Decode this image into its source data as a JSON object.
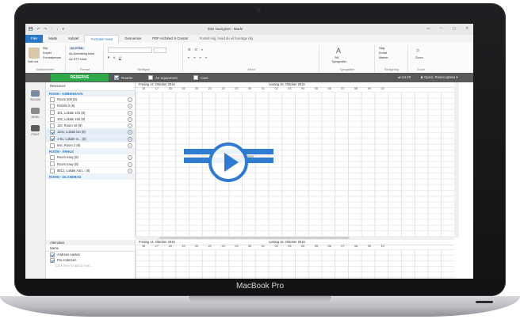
{
  "device": {
    "brand_label": "MacBook Pro"
  },
  "window": {
    "title": "Ikke navngivet - Møde",
    "quick_access": [
      "💾",
      "↶",
      "↷",
      "↑",
      "↓",
      "▾"
    ],
    "controls": [
      "▭",
      "—",
      "▢",
      "✕"
    ]
  },
  "ribbon_tabs": [
    {
      "label": "Filer",
      "style": "file"
    },
    {
      "label": "Møde",
      "style": ""
    },
    {
      "label": "Indsæt",
      "style": ""
    },
    {
      "label": "Formatér tekst",
      "style": "active"
    },
    {
      "label": "Gennemse",
      "style": ""
    },
    {
      "label": "PDF Architect 6 Creator",
      "style": ""
    },
    {
      "label": "Fortæl mig, hvad du vil foretage dig",
      "style": "tell"
    }
  ],
  "ribbon": {
    "clipboard": {
      "paste": "Sæt ind",
      "cut": "Klip",
      "copy": "Kopiér",
      "painter": "Formatpensel",
      "label": "Udklipsholder"
    },
    "format": {
      "html": "Aa HTML",
      "plain": "Aa Almindelig tekst",
      "rtf": "Aa RTF-tekst",
      "label": "Format"
    },
    "font": {
      "label": "Skrifttype"
    },
    "paragraph": {
      "label": "Afsnit"
    },
    "styles": {
      "label": "Typografier",
      "btn": "Stil",
      "btn2": "Typografier"
    },
    "editing": {
      "find": "Søg",
      "replace": "Erstat",
      "select": "Markér",
      "label": "Redigering"
    },
    "zoom": {
      "btn": "Zoom",
      "label": "Zoom"
    }
  },
  "toolbar": {
    "reserve": "RESERVE",
    "opt_rooms": "Rooms",
    "opt_equipment": "An equipment",
    "opt_cars": "Cars",
    "timezone": "⇄ 24.25",
    "user": "♟ Djord, Rivercoptera ▾"
  },
  "nav": [
    {
      "label": "ROOMS",
      "color": "#7a8aa0"
    },
    {
      "label": "MENU",
      "color": "#8a8a8a"
    },
    {
      "label": "PRINT",
      "color": "#5a5a5a"
    }
  ],
  "resources": {
    "header": "Resources",
    "section1": "ROOM - KØBENHAVN",
    "rows1": [
      {
        "label": "Room 200 (8)",
        "checked": false,
        "sel": false
      },
      {
        "label": "ROOM 2 (8)",
        "checked": false,
        "sel": false
      },
      {
        "label": "101, Lokale 101 (8)",
        "checked": false,
        "sel": false
      },
      {
        "label": "102, Lokale 102 (8)",
        "checked": false,
        "sel": false
      },
      {
        "label": "110, Room 10 (8)",
        "checked": false,
        "sel": false
      },
      {
        "label": "1104, Lokale lan (8)",
        "checked": true,
        "sel": true
      },
      {
        "label": "1-01, Lokale m... (8)",
        "checked": true,
        "sel": true
      },
      {
        "label": "test, Room 2 (8)",
        "checked": false,
        "sel": false
      }
    ],
    "section2": "ROOM - ÅRHUS",
    "rows2": [
      {
        "label": "Room easy (8)",
        "checked": false,
        "sel": false
      },
      {
        "label": "Room easy (8)",
        "checked": false,
        "sel": false
      },
      {
        "label": "8812, Lokale Aart... (8)",
        "checked": false,
        "sel": false
      }
    ],
    "section3": "ROOM - ISLANDBAD"
  },
  "calendar": {
    "day1": "Fredag 14. Oktober 2016",
    "day2": "Lørdag 15. Oktober 2016",
    "hours": [
      "16",
      "17",
      "18",
      "19",
      "20",
      "21",
      "22",
      "23",
      "00",
      "01",
      "02",
      "03",
      "04",
      "05",
      "06",
      "07",
      "08",
      "09",
      "10"
    ],
    "booking": "Reservation"
  },
  "attendees": {
    "header": "Attendees",
    "name_col": "Name",
    "rows": [
      {
        "label": "Andreas Aastan",
        "checked": true
      },
      {
        "label": "Pia Andersen",
        "checked": true
      }
    ],
    "hint": "Click here to add a new ..."
  }
}
